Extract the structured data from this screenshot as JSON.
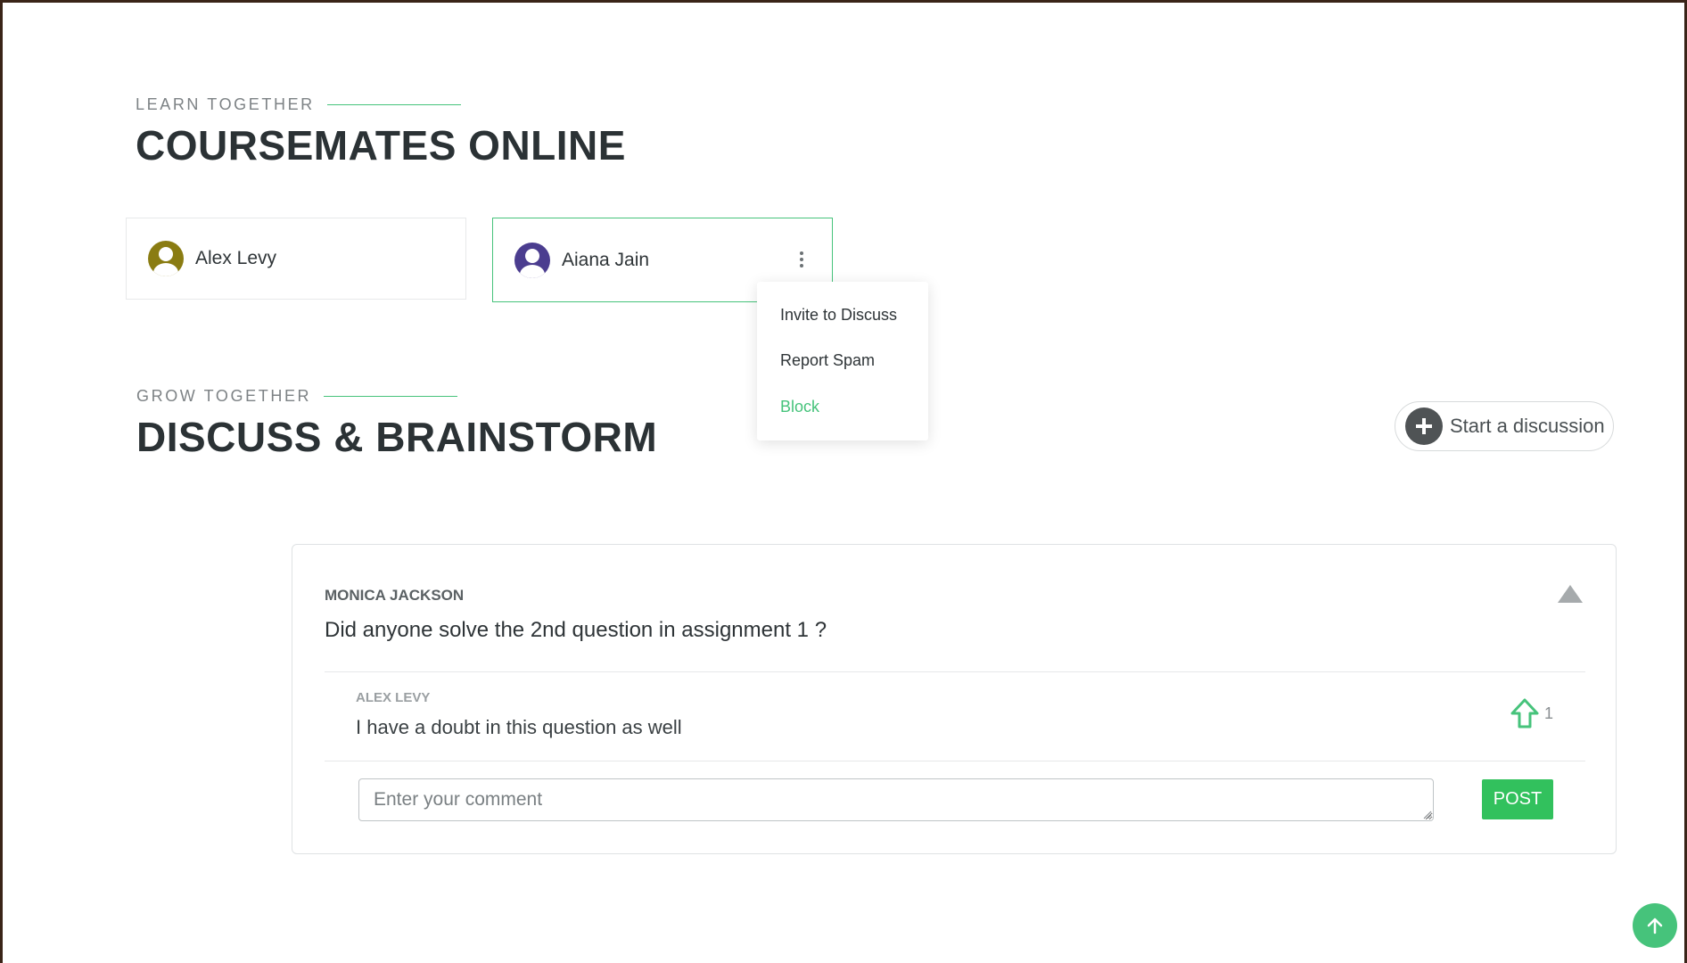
{
  "coursemates": {
    "eyebrow": "LEARN TOGETHER",
    "title": "COURSEMATES ONLINE",
    "mates": [
      {
        "name": "Alex Levy",
        "avatar_color": "#8a7c12"
      },
      {
        "name": "Aiana Jain",
        "avatar_color": "#4b3d8f"
      }
    ],
    "menu": {
      "items": [
        "Invite to Discuss",
        "Report Spam",
        "Block"
      ]
    }
  },
  "discussions": {
    "eyebrow": "GROW TOGETHER",
    "title": "DISCUSS & BRAINSTORM",
    "start_label": "Start a discussion",
    "thread": {
      "author": "MONICA JACKSON",
      "question": "Did anyone solve the 2nd question in assignment 1 ?",
      "comment": {
        "author": "ALEX LEVY",
        "text": "I have a doubt in this question as well",
        "votes": "1"
      },
      "comment_placeholder": "Enter your comment",
      "post_label": "POST"
    }
  },
  "colors": {
    "accent": "#46c37b",
    "post_button": "#32c15d",
    "heading": "#2b3235"
  }
}
